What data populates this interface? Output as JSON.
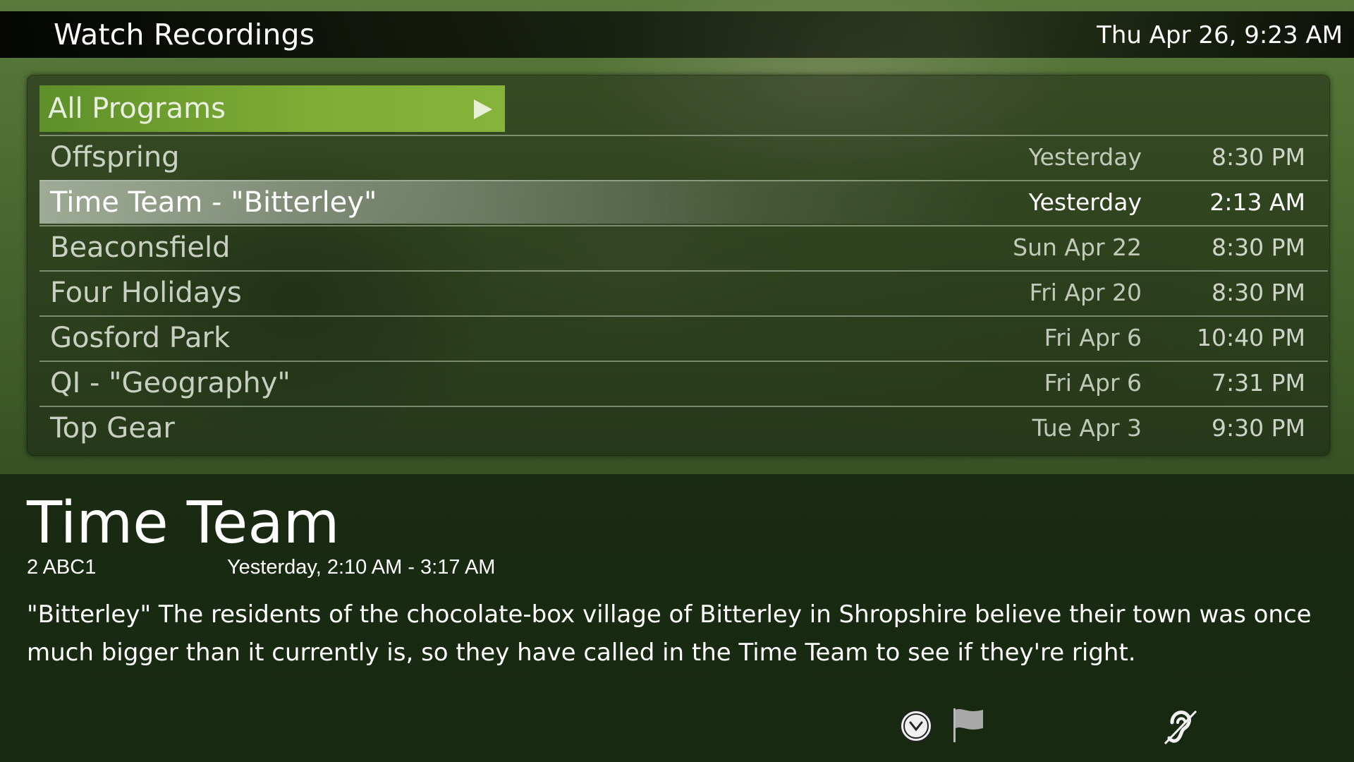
{
  "header": {
    "title": "Watch Recordings",
    "clock": "Thu Apr 26, 9:23 AM"
  },
  "filter": {
    "label": "All Programs",
    "icon": "play-icon"
  },
  "recordings": [
    {
      "title": "Offspring",
      "date": "Yesterday",
      "time": "8:30 PM",
      "selected": false
    },
    {
      "title": "Time Team - \"Bitterley\"",
      "date": "Yesterday",
      "time": "2:13 AM",
      "selected": true
    },
    {
      "title": "Beaconsfield",
      "date": "Sun Apr 22",
      "time": "8:30 PM",
      "selected": false
    },
    {
      "title": "Four Holidays",
      "date": "Fri Apr 20",
      "time": "8:30 PM",
      "selected": false
    },
    {
      "title": "Gosford Park",
      "date": "Fri Apr 6",
      "time": "10:40 PM",
      "selected": false
    },
    {
      "title": "QI - \"Geography\"",
      "date": "Fri Apr 6",
      "time": "7:31 PM",
      "selected": false
    },
    {
      "title": "Top Gear",
      "date": "Tue Apr 3",
      "time": "9:30 PM",
      "selected": false
    }
  ],
  "details": {
    "title": "Time Team",
    "channel": "2 ABC1",
    "airtime": "Yesterday, 2:10 AM - 3:17 AM",
    "description": "\"Bitterley\"  The residents of the chocolate-box village of Bitterley in Shropshire believe their town was once much bigger than it currently is, so they have called in the Time Team to see if they're right.",
    "icons": [
      "clock-icon",
      "flag-icon",
      "hearing-assistance-icon"
    ]
  },
  "colors": {
    "filter_accent": "#7fae35",
    "selection_highlight": "#c8d2c3"
  }
}
